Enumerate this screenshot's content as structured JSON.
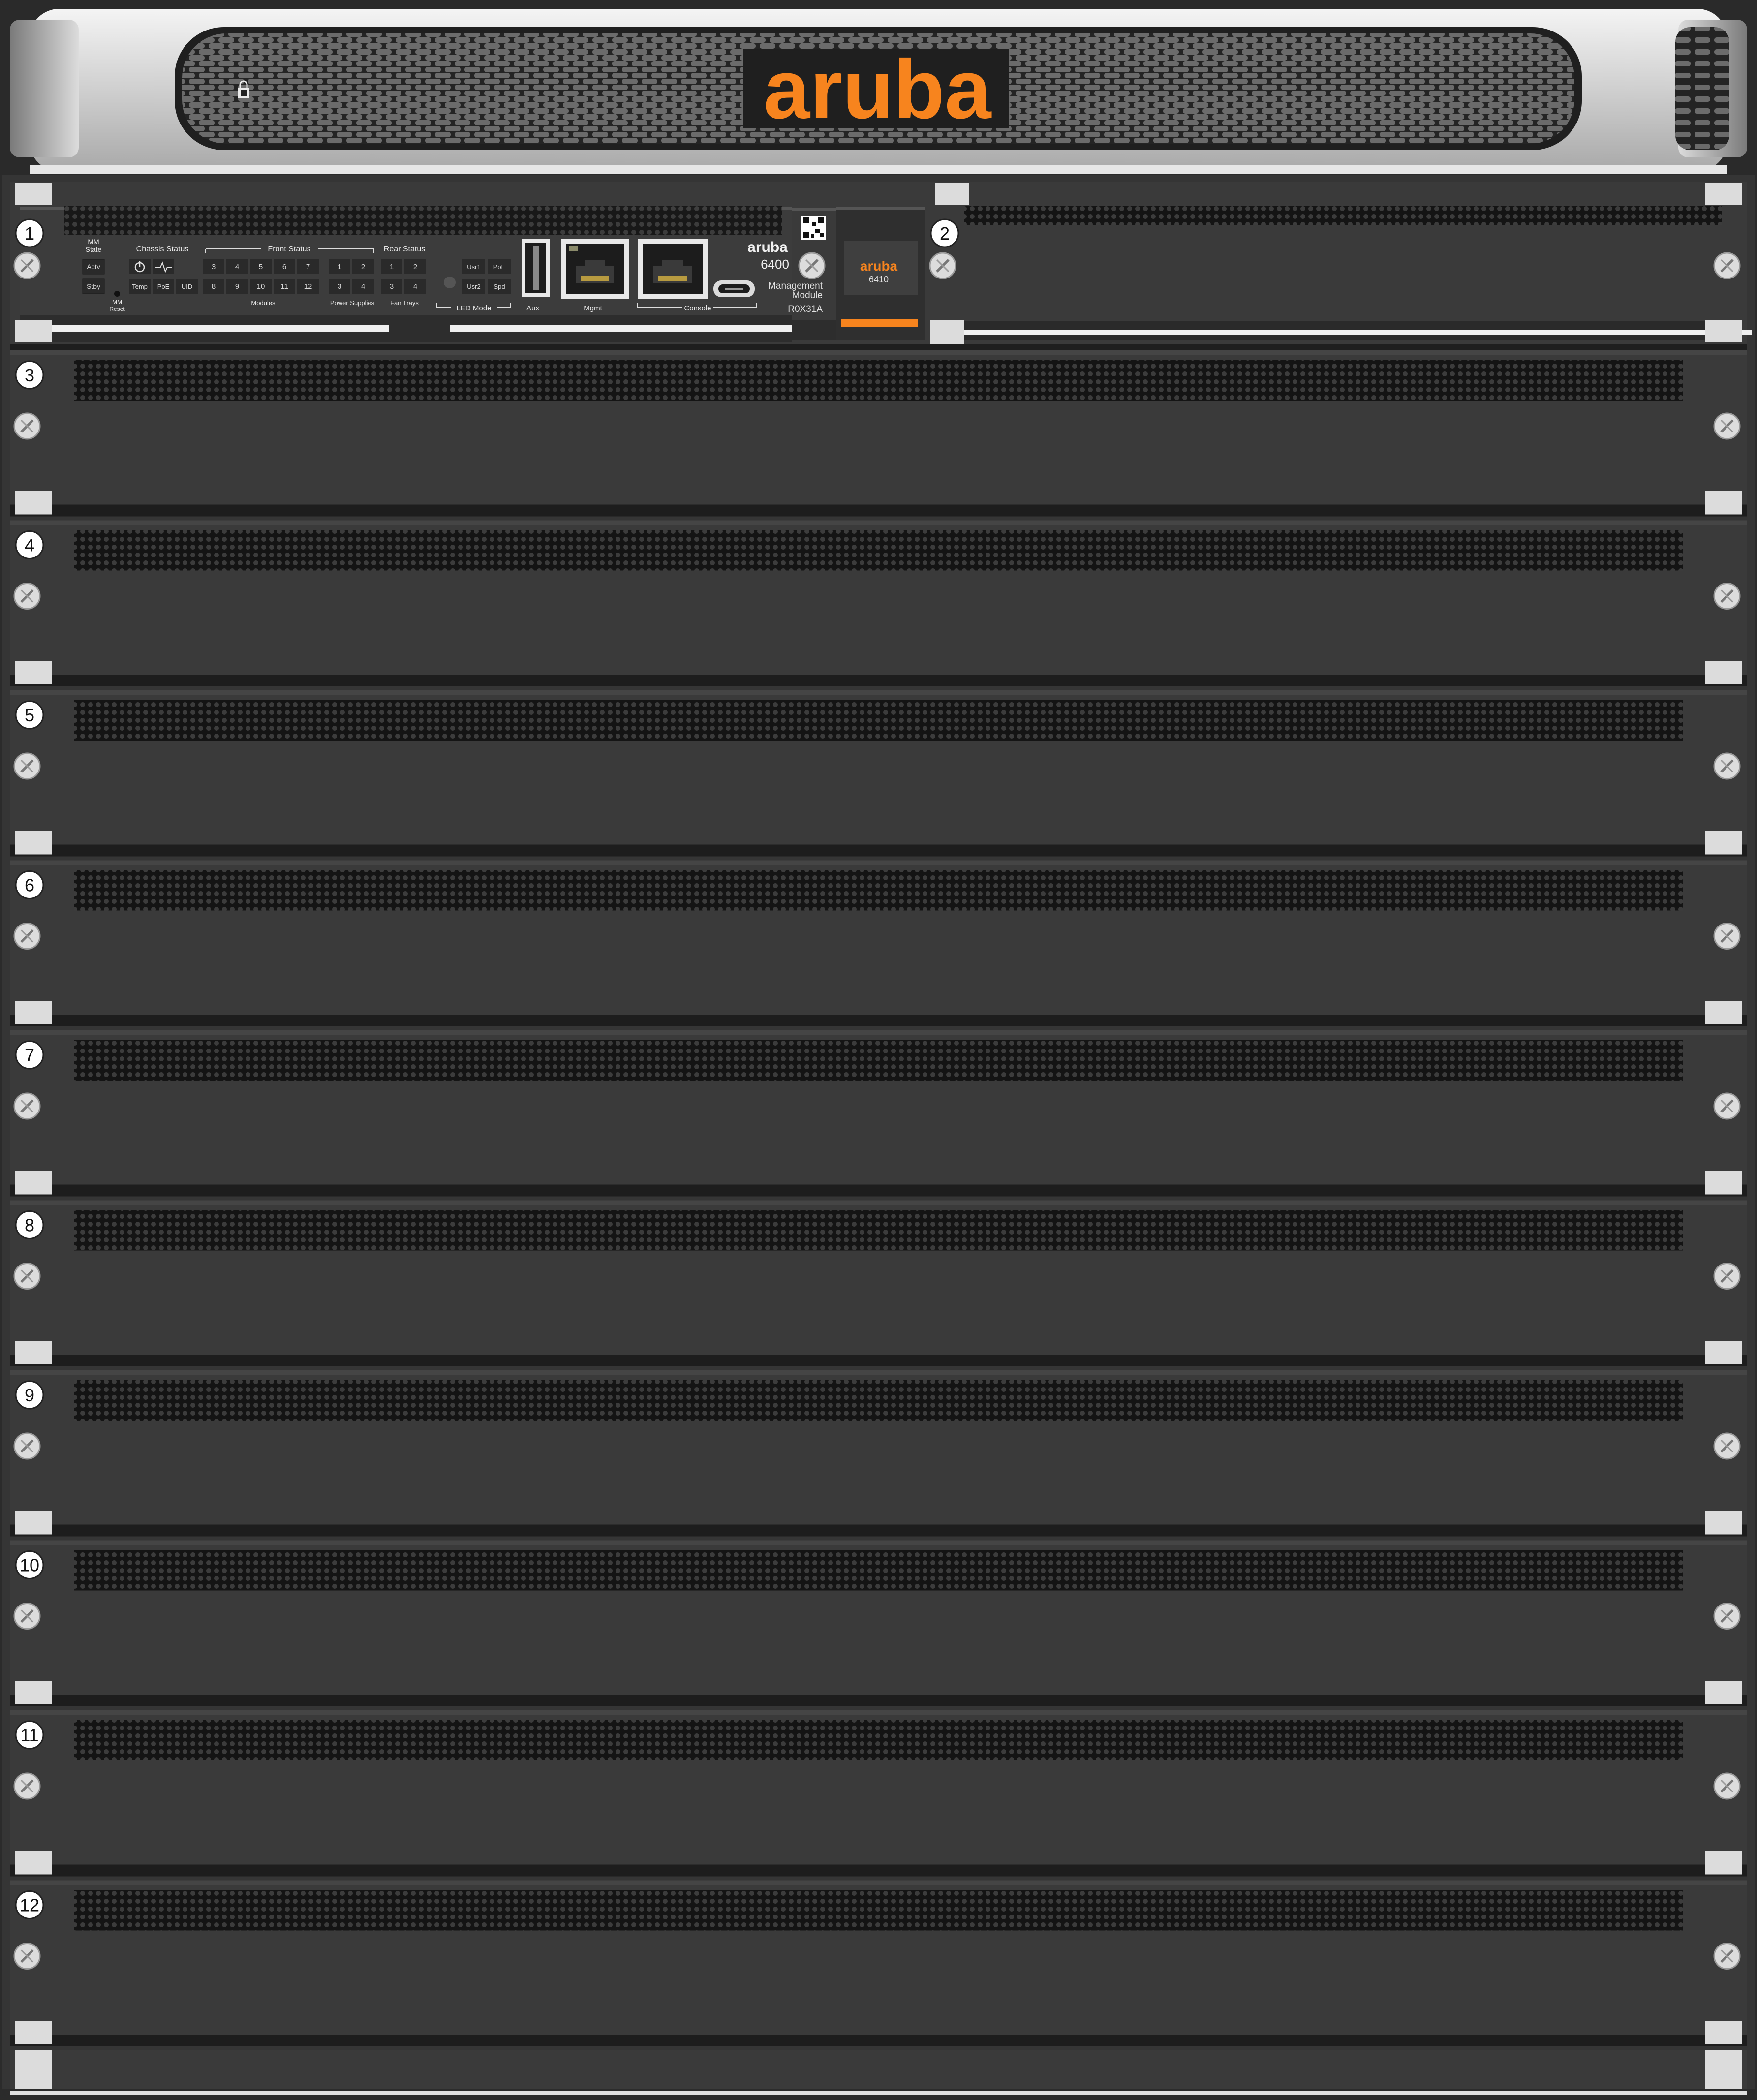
{
  "bezel": {
    "brand": "aruba"
  },
  "management_module": {
    "brand": "aruba",
    "series": "6400",
    "desc_line1": "Management",
    "desc_line2": "Module",
    "part_number": "R0X31A",
    "labels": {
      "mm_state_1": "MM",
      "mm_state_2": "State",
      "actv": "Actv",
      "stby": "Stby",
      "mm_reset_1": "MM",
      "mm_reset_2": "Reset",
      "chassis_status": "Chassis Status",
      "temp": "Temp",
      "poe": "PoE",
      "uid": "UID",
      "front_status": "Front Status",
      "modules": "Modules",
      "power_supplies": "Power Supplies",
      "rear_status": "Rear Status",
      "fan_trays": "Fan Trays",
      "led_mode": "LED Mode",
      "usr1": "Usr1",
      "usr2": "Usr2",
      "led_poe": "PoE",
      "spd": "Spd",
      "aux": "Aux",
      "mgmt": "Mgmt",
      "console": "Console"
    },
    "module_leds_row1": [
      "3",
      "4",
      "5",
      "6",
      "7"
    ],
    "module_leds_row2": [
      "8",
      "9",
      "10",
      "11",
      "12"
    ],
    "power_supply_leds_row1": [
      "1",
      "2"
    ],
    "power_supply_leds_row2": [
      "3",
      "4"
    ],
    "fan_tray_leds_row1": [
      "1",
      "2"
    ],
    "fan_tray_leds_row2": [
      "3",
      "4"
    ]
  },
  "slot2_module": {
    "brand": "aruba",
    "model": "6410"
  },
  "slots": [
    "1",
    "2",
    "3",
    "4",
    "5",
    "6",
    "7",
    "8",
    "9",
    "10",
    "11",
    "12"
  ],
  "colors": {
    "brand_orange": "#f7841e",
    "panel_dark": "#3a3a3a",
    "bezel_silver": "#c8c8c8",
    "frame": "#2b2b2b"
  }
}
